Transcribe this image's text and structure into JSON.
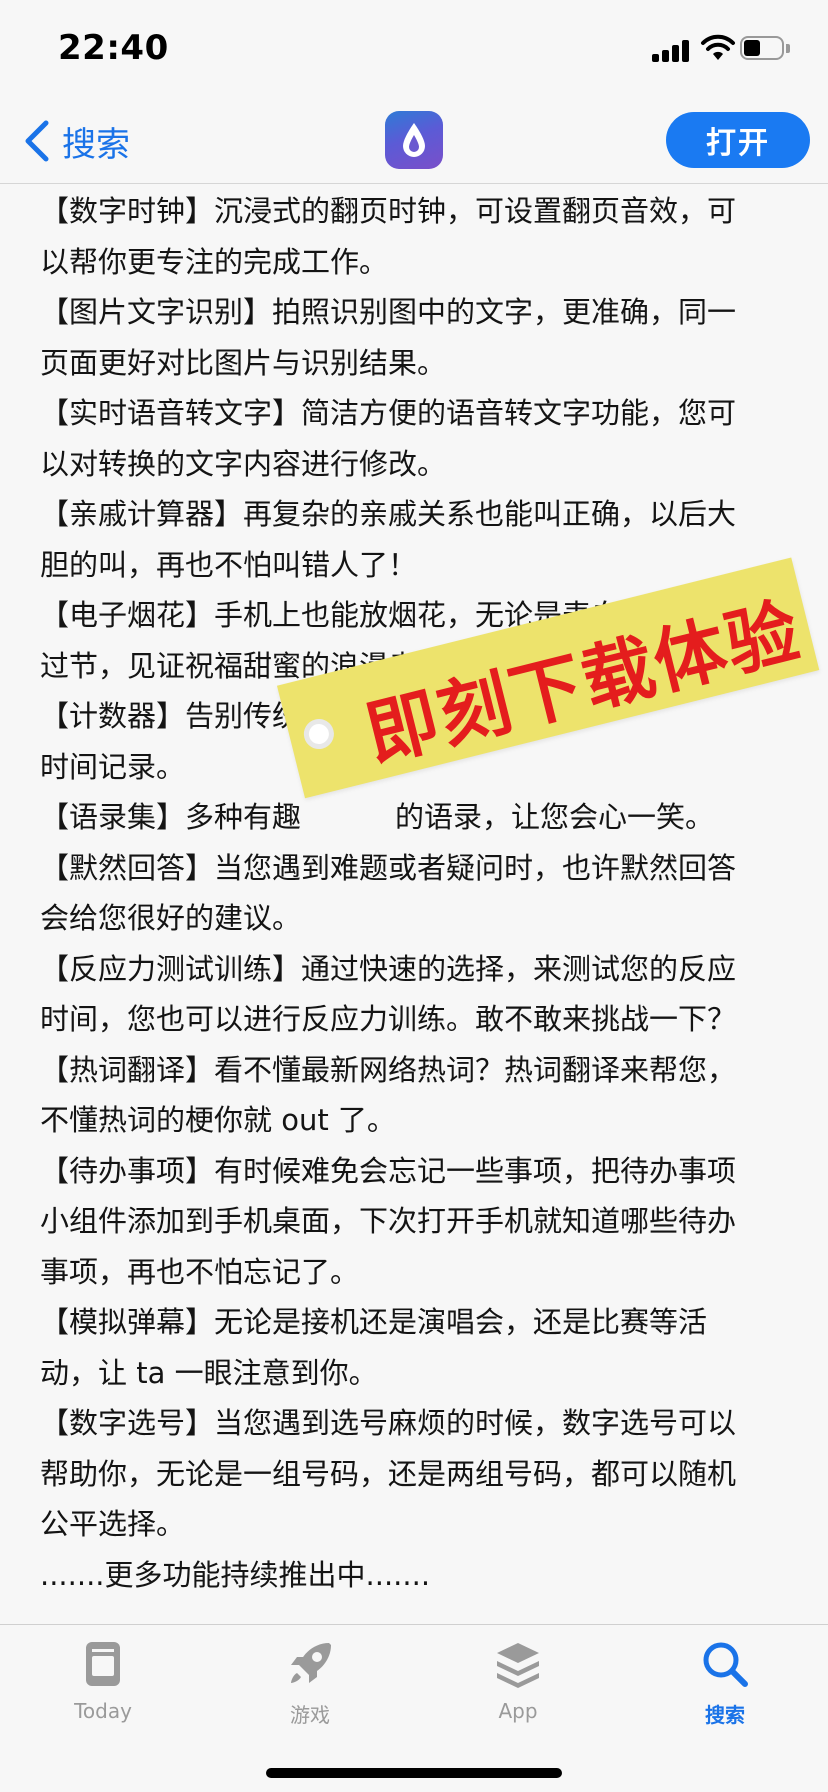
{
  "status_bar": {
    "time": "22:40",
    "battery_icon": "battery-icon",
    "wifi_icon": "wifi-icon",
    "signal_icon": "cellular-signal-icon"
  },
  "nav": {
    "back_label": "搜索",
    "back_icon": "chevron-left-icon",
    "app_icon": "water-drop-app-icon",
    "open_label": "打开",
    "accent_color": "#1a7af2"
  },
  "description_lines": [
    "【数字时钟】沉浸式的翻页时钟，可设置翻页音效，可",
    "以帮你更专注的完成工作。",
    "【图片文字识别】拍照识别图中的文字，更准确，同一",
    "页面更好对比图片与识别结果。",
    "【实时语音转文字】简洁方便的语音转文字功能，您可",
    "以对转换的文字内容进行修改。",
    "【亲戚计算器】再复杂的亲戚关系也能叫正确，以后大",
    "胆的叫，再也不怕叫错人了！",
    "【电子烟花】手机上也能放烟花，无论是表白还是过年",
    "过节，见证祝福甜蜜的浪漫幸福时刻。",
    "【计数器】告别传统手动的",
    "时间记录。",
    "【语录集】多种有趣",
    "【默然回答】当您遇到难题或者疑问时，也许默然回答",
    "会给您很好的建议。",
    "【反应力测试训练】通过快速的选择，来测试您的反应",
    "时间，您也可以进行反应力训练。敢不敢来挑战一下？",
    "【热词翻译】看不懂最新网络热词？热词翻译来帮您，",
    "不懂热词的梗你就 out 了。",
    "【待办事项】有时候难免会忘记一些事项，把待办事项",
    "小组件添加到手机桌面，下次打开手机就知道哪些待办",
    "事项，再也不怕忘记了。",
    "【模拟弹幕】无论是接机还是演唱会，还是比赛等活",
    "动，让 ta 一眼注意到你。",
    "【数字选号】当您遇到选号麻烦的时候，数字选号可以",
    "帮助你，无论是一组号码，还是两组号码，都可以随机",
    "公平选择。",
    ".......更多功能持续推出中......."
  ],
  "line_12_tail": "的语录，让您会心一笑。",
  "stamp": {
    "text": "即刻下载体验",
    "background": "#ede36c",
    "text_color": "#e41d1d"
  },
  "tabs": [
    {
      "label": "Today",
      "icon": "today-icon"
    },
    {
      "label": "游戏",
      "icon": "rocket-icon"
    },
    {
      "label": "App",
      "icon": "app-stack-icon"
    },
    {
      "label": "搜索",
      "icon": "search-icon",
      "active": true
    }
  ]
}
